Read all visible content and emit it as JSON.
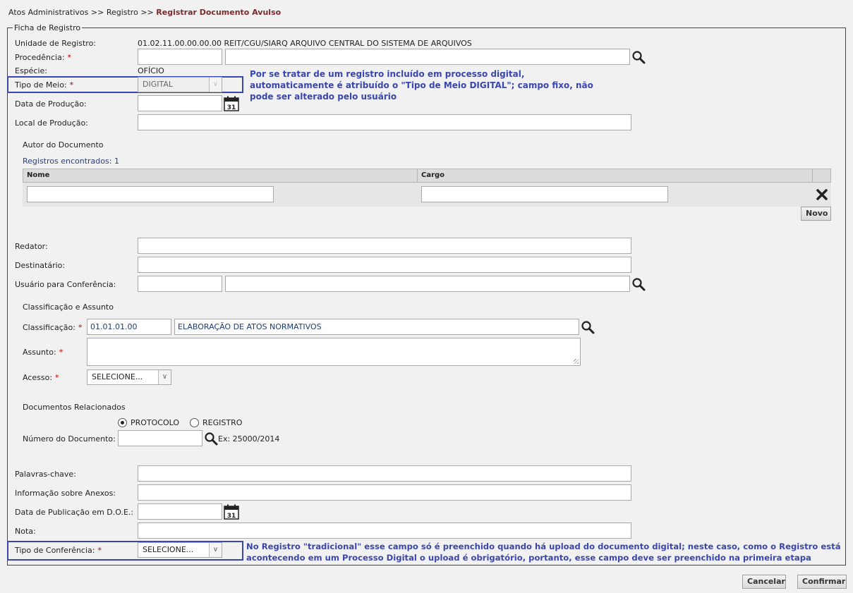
{
  "breadcrumb": {
    "part1": "Atos Administrativos",
    "sep1": ">>",
    "part2": "Registro",
    "sep2": ">>",
    "current": "Registrar Documento Avulso"
  },
  "ficha": {
    "legend": "Ficha de Registro",
    "unidade": {
      "label": "Unidade de Registro:",
      "value": "01.02.11.00.00.00.00 REIT/CGU/SIARQ ARQUIVO CENTRAL DO SISTEMA DE ARQUIVOS"
    },
    "procedencia": {
      "label": "Procedência:",
      "req": "*",
      "code": "",
      "name": ""
    },
    "especie": {
      "label": "Espécie:",
      "value": "OFÍCIO"
    },
    "tipo_meio": {
      "label": "Tipo de Meio:",
      "req": "*",
      "value": "DIGITAL"
    },
    "data_producao": {
      "label": "Data de Produção:",
      "value": ""
    },
    "local_producao": {
      "label": "Local de Produção:",
      "value": ""
    },
    "redator": {
      "label": "Redator:",
      "value": ""
    },
    "destinatario": {
      "label": "Destinatário:",
      "value": ""
    },
    "usuario_conf": {
      "label": "Usuário para Conferência:",
      "code": "",
      "name": ""
    },
    "palavras": {
      "label": "Palavras-chave:",
      "value": ""
    },
    "info_anexos": {
      "label": "Informação sobre Anexos:",
      "value": ""
    },
    "data_pub": {
      "label": "Data de Publicação em D.O.E.:",
      "value": ""
    },
    "nota": {
      "label": "Nota:",
      "value": ""
    },
    "tipo_conf": {
      "label": "Tipo de Conferência:",
      "req": "*",
      "value": "SELECIONE..."
    }
  },
  "calendar_day": "31",
  "autor": {
    "legend": "Autor do Documento",
    "count": "Registros encontrados: 1",
    "columns": [
      "Nome",
      "Cargo"
    ],
    "row": {
      "nome": "",
      "cargo": ""
    },
    "novo": "Novo"
  },
  "classif": {
    "legend": "Classificação e Assunto",
    "classificacao": {
      "label": "Classificação:",
      "req": "*",
      "code": "01.01.01.00",
      "name": "ELABORAÇÃO DE ATOS NORMATIVOS"
    },
    "assunto": {
      "label": "Assunto:",
      "req": "*",
      "value": ""
    },
    "acesso": {
      "label": "Acesso:",
      "req": "*",
      "value": "SELECIONE..."
    }
  },
  "docs_rel": {
    "legend": "Documentos Relacionados",
    "opt1": "PROTOCOLO",
    "opt2": "REGISTRO",
    "selected": "PROTOCOLO",
    "numero": {
      "label": "Número do Documento:",
      "value": ""
    },
    "example": "Ex: 25000/2014"
  },
  "notes": {
    "tipo_meio_line1": "Por se tratar de um registro incluído em processo digital,",
    "tipo_meio_line2": "automaticamente é atribuído o \"Tipo de Meio DIGITAL\"; campo fixo, não",
    "tipo_meio_line3": "pode ser alterado pelo usuário",
    "tipo_conf_line1": "No Registro \"tradicional\" esse campo só é preenchido quando há upload do documento digital; neste caso, como o Registro está",
    "tipo_conf_line2": "acontecendo em um Processo Digital o upload é obrigatório, portanto, esse campo deve ser preenchido na primeira etapa"
  },
  "buttons": {
    "cancelar": "Cancelar",
    "confirmar": "Confirmar"
  },
  "colors": {
    "accent": "#3a46b0",
    "breadcrumb_current": "#7a2b2b",
    "required": "#b30000"
  }
}
